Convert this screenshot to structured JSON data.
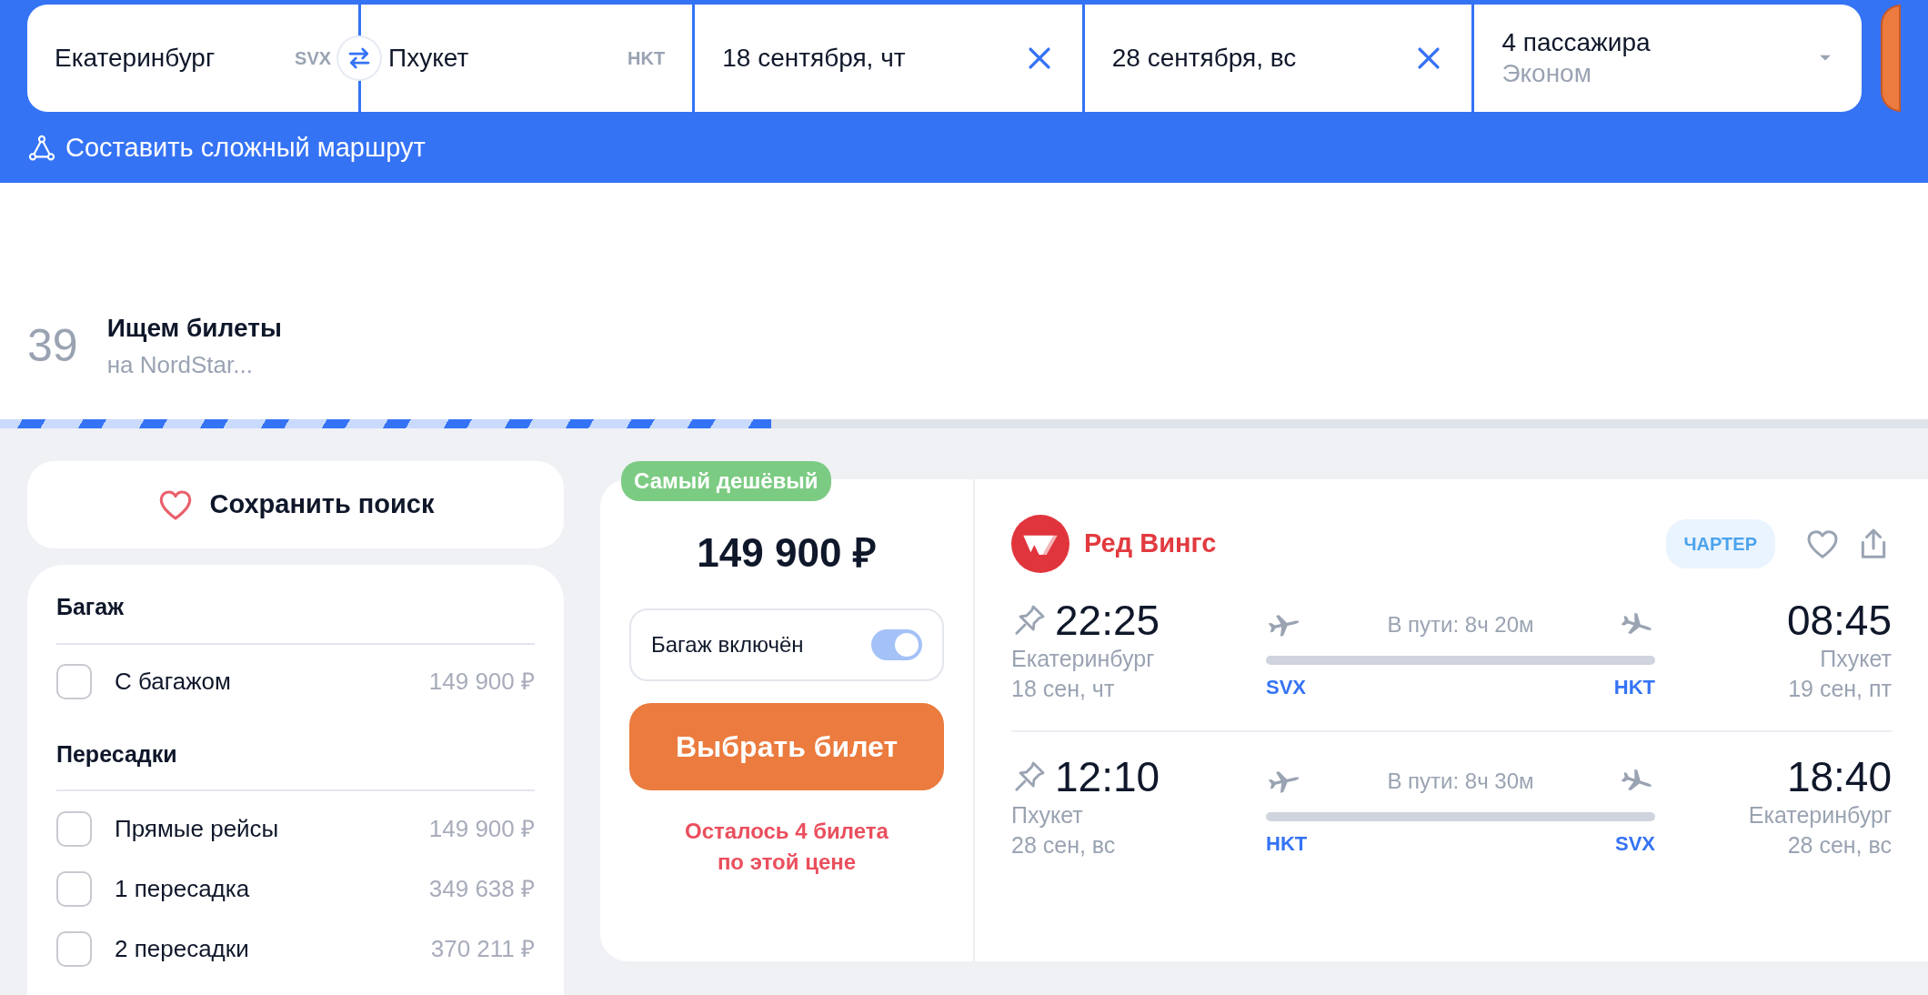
{
  "search_form": {
    "origin": {
      "city": "Екатеринбург",
      "code": "SVX"
    },
    "destination": {
      "city": "Пхукет",
      "code": "HKT"
    },
    "departure_date": "18 сентября, чт",
    "return_date": "28 сентября, вс",
    "passengers": {
      "count": "4 пассажира",
      "cabin": "Эконом"
    },
    "complex_route_link": "Составить сложный маршрут"
  },
  "search_progress": {
    "count": "39",
    "title": "Ищем билеты",
    "subtitle": "на NordStar...",
    "level": 0.4
  },
  "save_search_button": "Сохранить поиск",
  "filters": [
    {
      "title": "Багаж",
      "options": [
        {
          "label": "С багажом",
          "price": "149 900 ₽",
          "checked": false
        }
      ]
    },
    {
      "title": "Пересадки",
      "options": [
        {
          "label": "Прямые рейсы",
          "price": "149 900 ₽",
          "checked": false
        },
        {
          "label": "1 пересадка",
          "price": "349 638 ₽",
          "checked": false
        },
        {
          "label": "2 пересадки",
          "price": "370 211 ₽",
          "checked": false
        }
      ]
    }
  ],
  "ticket": {
    "badge": "Самый дешёвый",
    "price": "149 900 ₽",
    "baggage_toggle": {
      "label": "Багаж включён",
      "on": true
    },
    "select_button": "Выбрать билет",
    "availability_note": "Осталось 4 билета по этой цене",
    "airline": "Ред Вингс",
    "tag": "ЧАРТЕР",
    "segments": [
      {
        "dep_time": "22:25",
        "dep_city": "Екатеринбург",
        "dep_date": "18 сен, чт",
        "dep_code": "SVX",
        "duration": "В пути: 8ч 20м",
        "arr_time": "08:45",
        "arr_city": "Пхукет",
        "arr_date": "19 сен, пт",
        "arr_code": "HKT"
      },
      {
        "dep_time": "12:10",
        "dep_city": "Пхукет",
        "dep_date": "28 сен, вс",
        "dep_code": "HKT",
        "duration": "В пути: 8ч 30м",
        "arr_time": "18:40",
        "arr_city": "Екатеринбург",
        "arr_date": "28 сен, вс",
        "arr_code": "SVX"
      }
    ]
  }
}
